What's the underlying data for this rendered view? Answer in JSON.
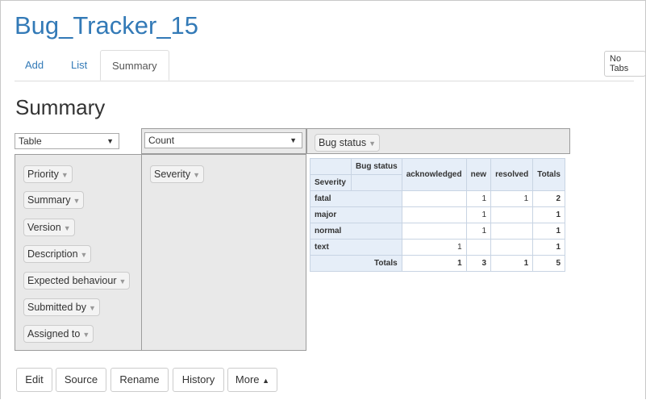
{
  "app": {
    "title": "Bug_Tracker_15"
  },
  "tabs": [
    {
      "label": "Add"
    },
    {
      "label": "List"
    },
    {
      "label": "Summary"
    }
  ],
  "no_tabs_label": "No Tabs",
  "section_title": "Summary",
  "pivot": {
    "renderer_select": "Table",
    "aggregator_select": "Count",
    "col_attr": "Bug status",
    "row_attr": "Severity",
    "unused_attrs": [
      "Priority",
      "Summary",
      "Version",
      "Description",
      "Expected behaviour",
      "Submitted by",
      "Assigned to"
    ],
    "table": {
      "col_header_label": "Bug status",
      "row_header_label": "Severity",
      "columns": [
        "acknowledged",
        "new",
        "resolved",
        "Totals"
      ],
      "rows": [
        {
          "label": "fatal",
          "values": [
            "",
            "1",
            "1",
            "2"
          ]
        },
        {
          "label": "major",
          "values": [
            "",
            "1",
            "",
            "1"
          ]
        },
        {
          "label": "normal",
          "values": [
            "",
            "1",
            "",
            "1"
          ]
        },
        {
          "label": "text",
          "values": [
            "1",
            "",
            "",
            "1"
          ]
        }
      ],
      "totals_label": "Totals",
      "totals": [
        "1",
        "3",
        "1",
        "5"
      ]
    }
  },
  "buttons": {
    "edit": "Edit",
    "source": "Source",
    "rename": "Rename",
    "history": "History",
    "more": "More"
  },
  "icons": {
    "dropdown": "triangle-down-icon",
    "more_caret": "triangle-up-icon"
  }
}
